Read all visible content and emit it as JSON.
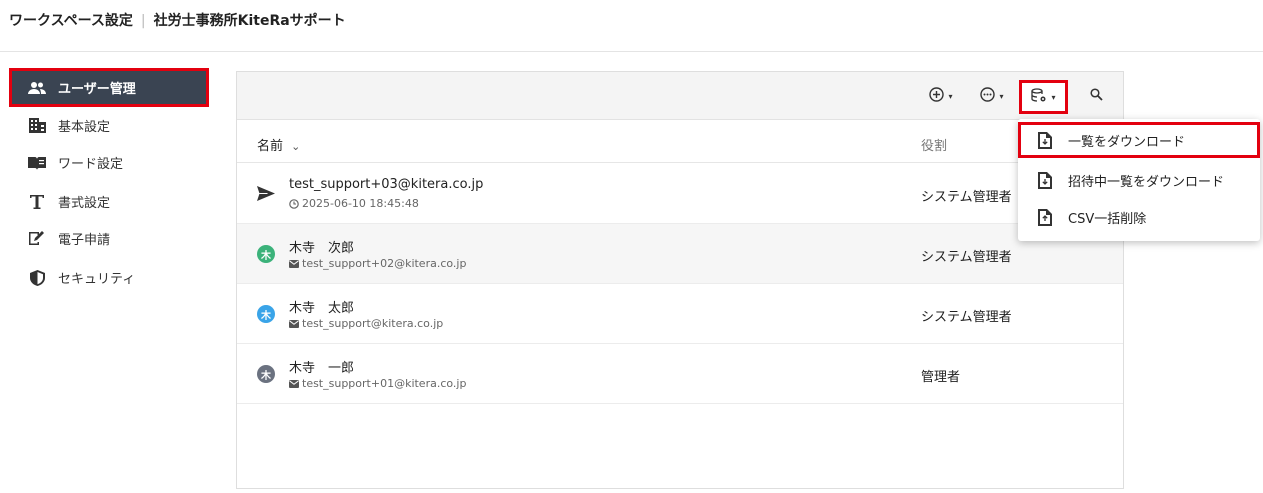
{
  "header": {
    "workspace_label": "ワークスペース設定",
    "separator": "|",
    "org_name": "社労士事務所KiteRaサポート"
  },
  "sidebar": {
    "items": [
      {
        "label": "ユーザー管理",
        "icon": "users-icon",
        "active": true
      },
      {
        "label": "基本設定",
        "icon": "building-icon",
        "active": false
      },
      {
        "label": "ワード設定",
        "icon": "book-icon",
        "active": false
      },
      {
        "label": "書式設定",
        "icon": "text-format-icon",
        "active": false
      },
      {
        "label": "電子申請",
        "icon": "edit-document-icon",
        "active": false
      },
      {
        "label": "セキュリティ",
        "icon": "shield-icon",
        "active": false
      }
    ]
  },
  "toolbar": {
    "add_icon": "add-circle-icon",
    "more_icon": "more-circle-icon",
    "export_icon": "database-settings-icon",
    "search_icon": "search-icon",
    "caret": "▾"
  },
  "table": {
    "columns": {
      "name": "名前",
      "role": "役割"
    },
    "sort_indicator": "⌄",
    "rows": [
      {
        "type": "invite",
        "name": "test_support+03@kitera.co.jp",
        "sub": "2025-06-10 18:45:48",
        "role": "システム管理者",
        "avatar": "",
        "avatar_color": ""
      },
      {
        "type": "user",
        "name": "木寺　次郎",
        "sub": "test_support+02@kitera.co.jp",
        "role": "システム管理者",
        "avatar": "木",
        "avatar_color": "#3bb27a"
      },
      {
        "type": "user",
        "name": "木寺　太郎",
        "sub": "test_support@kitera.co.jp",
        "role": "システム管理者",
        "avatar": "木",
        "avatar_color": "#3aa4e8"
      },
      {
        "type": "user",
        "name": "木寺　一郎",
        "sub": "test_support+01@kitera.co.jp",
        "role": "管理者",
        "avatar": "木",
        "avatar_color": "#6b7280"
      }
    ]
  },
  "dropdown": {
    "items": [
      {
        "label": "一覧をダウンロード",
        "icon": "file-download-icon"
      },
      {
        "label": "招待中一覧をダウンロード",
        "icon": "file-download-icon"
      },
      {
        "label": "CSV一括削除",
        "icon": "file-upload-icon"
      }
    ]
  },
  "colors": {
    "highlight": "#e3000f",
    "active_nav": "#3a4452"
  }
}
